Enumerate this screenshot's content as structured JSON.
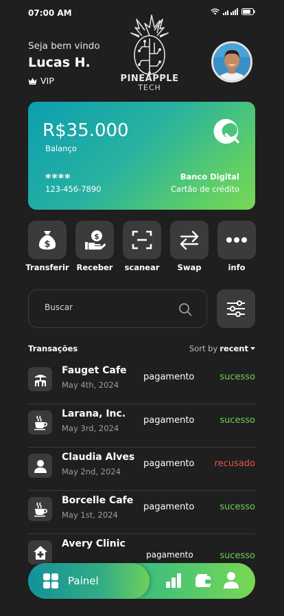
{
  "status_bar": {
    "time": "07:00 AM"
  },
  "header": {
    "greeting": "Seja bem vindo",
    "name": "Lucas H.",
    "badge": "VIP",
    "logo_line1": "PINEAPPLE",
    "logo_line2": "TECH"
  },
  "card": {
    "balance": "R$35.000",
    "balance_label": "Balanço",
    "masked": "****",
    "number": "123-456-7890",
    "bank": "Banco Digital",
    "type": "Cartão de crédito"
  },
  "actions": [
    {
      "label": "Transferir",
      "icon": "money-bag-icon"
    },
    {
      "label": "Receber",
      "icon": "receive-money-icon"
    },
    {
      "label": "scanear",
      "icon": "scan-icon"
    },
    {
      "label": "Swap",
      "icon": "swap-icon"
    },
    {
      "label": "info",
      "icon": "more-dots-icon"
    }
  ],
  "search": {
    "placeholder": "Buscar"
  },
  "transactions": {
    "title": "Transações",
    "sort_prefix": "Sort by",
    "sort_value": "recent",
    "rows": [
      {
        "name": "Fauget Cafe",
        "date": "May 4th, 2024",
        "type": "pagamento",
        "status": "sucesso",
        "icon": "cafe-table-icon"
      },
      {
        "name": "Larana, Inc.",
        "date": "May 3rd, 2024",
        "type": "pagamento",
        "status": "sucesso",
        "icon": "coffee-cup-icon"
      },
      {
        "name": "Claudia Alves",
        "date": "May 2nd, 2024",
        "type": "pagamento",
        "status": "recusado",
        "icon": "person-icon"
      },
      {
        "name": "Borcelle Cafe",
        "date": "May 1st, 2024",
        "type": "pagamento",
        "status": "sucesso",
        "icon": "coffee-cup-icon"
      },
      {
        "name": "Avery Clinic",
        "date": "",
        "type": "pagamento",
        "status": "sucesso",
        "icon": "clinic-icon"
      }
    ]
  },
  "nav": {
    "active_label": "Painel"
  },
  "colors": {
    "success": "#6fcf5a",
    "declined": "#e5534b",
    "accent_start": "#0d9fb0",
    "accent_end": "#7ad754"
  }
}
